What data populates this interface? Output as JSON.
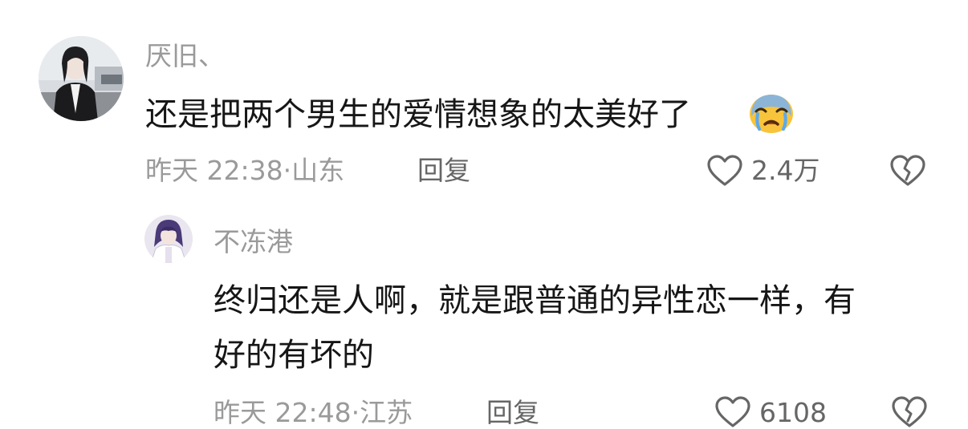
{
  "comments": [
    {
      "username": "厌旧、",
      "text": "还是把两个男生的爱情想象的太美好了",
      "emoji": "crying-face",
      "time": "昨天 22:38",
      "location": "山东",
      "reply_label": "回复",
      "likes": "2.4万"
    }
  ],
  "replies": [
    {
      "username": "不冻港",
      "text_line1": "终归还是人啊，就是跟普通的异性恋一样，有",
      "text_line2": "好的有坏的",
      "time": "昨天 22:48",
      "location": "江苏",
      "reply_label": "回复",
      "likes": "6108"
    }
  ],
  "colors": {
    "text": "#161616",
    "muted": "#9a9a9a",
    "action": "#666666"
  }
}
